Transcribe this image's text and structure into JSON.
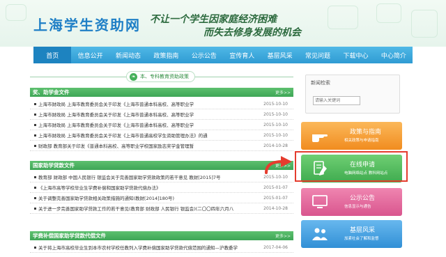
{
  "header": {
    "site_title": "上海学生资助网",
    "slogan_line1": "不让一个学生因家庭经济困难",
    "slogan_line2": "而失去修身发展的机会"
  },
  "nav": {
    "items": [
      "首页",
      "信息公开",
      "新闻动态",
      "政策指南",
      "公示公告",
      "宣传育人",
      "基层风采",
      "常见问题",
      "下载中心",
      "中心简介"
    ],
    "active": "首页"
  },
  "policy_tab": {
    "label": "本、专科教育资助政策"
  },
  "more_label": "更多>>",
  "sections": [
    {
      "title": "奖、助学金文件",
      "rows": [
        {
          "title": "上海市财政局 上海市教育委员会关于印发《上海市普通本科高校、高等职业学",
          "date": "2015-10-10"
        },
        {
          "title": "上海市财政局 上海市教育委员会关于印发《上海市普通本科高校、高等职业学",
          "date": "2015-10-10"
        },
        {
          "title": "上海市财政局 上海市教育委员会关于印发《上海市普通本科高校、高等职业学",
          "date": "2015-10-10"
        },
        {
          "title": "上海市财政局 上海市教育委员会关于印发《上海市普通高校学生资助管理办法》的通",
          "date": "2015-10-10"
        },
        {
          "title": "财政部 教育部关于印发《普通本科高校、高等职业学校国家励志奖学金管理暂",
          "date": "2014-10-28"
        }
      ]
    },
    {
      "title": "国家助学贷款文件",
      "rows": [
        {
          "title": "教育部 财政部 中国人民银行 银监会关于完善国家助学贷款政策的若干意见 教财[2015]7号",
          "date": "2015-10-10"
        },
        {
          "title": "《上海市高等学校毕业生学费补偿和国家助学贷款代偿办法》",
          "date": "2015-01-07"
        },
        {
          "title": "关于调整完善国家助学贷款相关政策措施的通知(教财[2014]180号)",
          "date": "2015-01-07"
        },
        {
          "title": "关于进一步完善国家助学贷款工作的若干意见(教育部 财政部 人民银行 银监会)(二〇〇四年六月八",
          "date": "2014-10-28"
        }
      ]
    },
    {
      "title": "学费补偿国家助学贷款代偿文件",
      "rows": [
        {
          "title": "关于将上海市高校毕业生到本市农村学校任教列入学费补偿国家助学贷款代偿范围的通知—沪教委学",
          "date": "2017-04-06"
        }
      ]
    }
  ],
  "sidebar": {
    "search_label": "新闻检索",
    "search_placeholder": "请输入关键词",
    "tiles": [
      {
        "title": "政策与指南",
        "sub": "相关政策与申请指南",
        "color": "#f39a2b",
        "icon": "hand-pointing-icon"
      },
      {
        "title": "在线申请",
        "sub": "电脑网络站点  教科网站点",
        "color": "#4db85a",
        "icon": "document-pen-icon"
      },
      {
        "title": "公示公告",
        "sub": "信息显示与通告",
        "color": "#df6a9a",
        "icon": "monitor-icon"
      },
      {
        "title": "基层风采",
        "sub": "加紧社会了解和监督",
        "color": "#3f9de0",
        "icon": "people-icon"
      }
    ]
  },
  "highlight": {
    "target": "在线申请",
    "color": "#e53c2e"
  }
}
